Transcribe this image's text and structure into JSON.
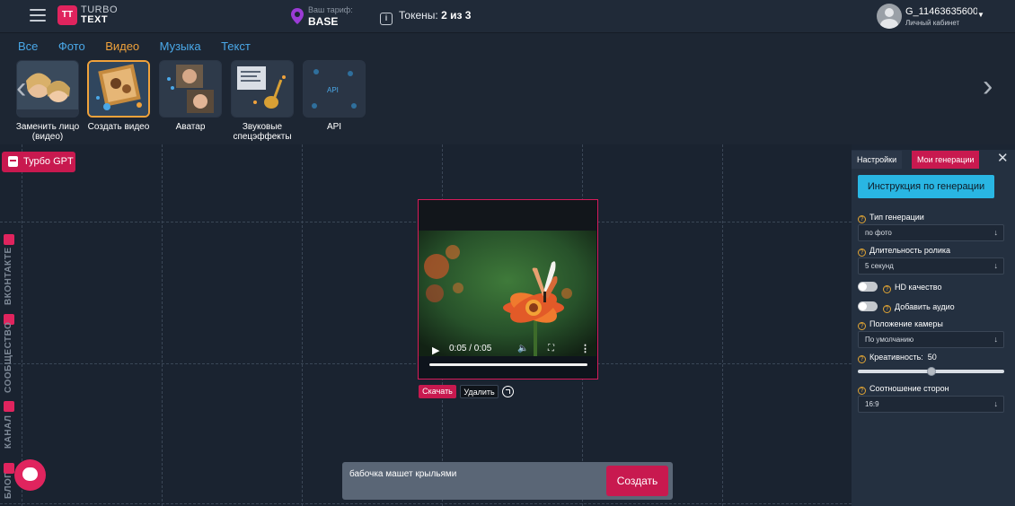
{
  "header": {
    "logo_mark": "TT",
    "logo_line1": "TURBO",
    "logo_line2": "TEXT",
    "tariff_label": "Ваш тариф:",
    "tariff_value": "BASE",
    "tokens_label": "Токены:",
    "tokens_value": "2 из 3",
    "user_name": "G_11463635600",
    "user_sub": "Личный кабинет"
  },
  "category_tabs": [
    {
      "label": "Все",
      "active": false
    },
    {
      "label": "Фото",
      "active": false
    },
    {
      "label": "Видео",
      "active": true
    },
    {
      "label": "Музыка",
      "active": false
    },
    {
      "label": "Текст",
      "active": false
    }
  ],
  "tools": [
    {
      "label": "Заменить лицо (видео)",
      "active": false
    },
    {
      "label": "Создать видео",
      "active": true
    },
    {
      "label": "Аватар",
      "active": false
    },
    {
      "label": "Звуковые спецэффекты",
      "active": false
    },
    {
      "label": "API",
      "active": false
    }
  ],
  "sidebar_left": {
    "turbo_gpt_label": "Турбо GPT",
    "links": [
      "ВКОНТАКТЕ",
      "СООБЩЕСТВО",
      "КАНАЛ",
      "БЛОГ"
    ]
  },
  "video": {
    "time": "0:05 / 0:05",
    "progress_fraction": 1.0,
    "download_label": "Скачать",
    "delete_label": "Удалить"
  },
  "prompt": {
    "text": "бабочка машет крыльями",
    "submit_label": "Создать"
  },
  "panel": {
    "tab_settings": "Настройки",
    "tab_mygen": "Мои генерации",
    "instruction_button": "Инструкция по генерации",
    "gen_type_label": "Тип генерации",
    "gen_type_value": "по фото",
    "duration_label": "Длительность ролика",
    "duration_value": "5 секунд",
    "hd_label": "HD качество",
    "audio_label": "Добавить аудио",
    "camera_label": "Положение камеры",
    "camera_value": "По умолчанию",
    "creativity_label": "Креативность:",
    "creativity_value": "50",
    "aspect_label": "Соотношение сторон",
    "aspect_value": "16:9"
  },
  "colors": {
    "accent_pink": "#c8194f",
    "accent_orange": "#f0a23b",
    "link_blue": "#4aa8e8",
    "instruction_cyan": "#29b6e3"
  }
}
